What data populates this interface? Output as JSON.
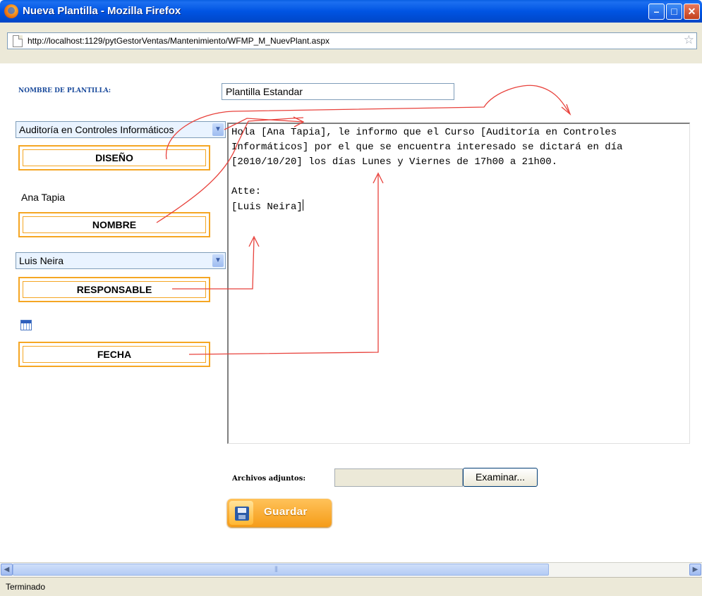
{
  "window": {
    "title": "Nueva Plantilla - Mozilla Firefox",
    "minimize": "–",
    "maximize": "□",
    "close": "✕"
  },
  "addressbar": {
    "url": "http://localhost:1129/pytGestorVentas/Mantenimiento/WFMP_M_NuevPlant.aspx",
    "bookmark_icon": "star-icon"
  },
  "form": {
    "nombre_label": "NOMBRE DE PLANTILLA:",
    "nombre_value": "Plantilla Estandar",
    "curso_select": "Auditoría en Controles Informáticos",
    "diseno_button": "DISEÑO",
    "alumno_name": "Ana Tapia",
    "nombre_button": "NOMBRE",
    "responsable_select": "Luis Neira",
    "responsable_button": "RESPONSABLE",
    "calendar_icon": "calendar-icon",
    "fecha_button": "FECHA",
    "editor_text": "Hola [Ana Tapia], le informo que el Curso [Auditoría en Controles Informáticos] por el que se encuentra interesado se dictará en día [2010/10/20] los días Lunes y Viernes de 17h00 a 21h00.\n\nAtte:\n[Luis Neira]",
    "adjuntos_label": "Archivos adjuntos:",
    "examinar_button": "Examinar...",
    "guardar_button": "Guardar"
  },
  "statusbar": {
    "text": "Terminado"
  },
  "colors": {
    "accent_orange": "#f5a623",
    "annotation_red": "#e8423c",
    "titlebar_blue": "#0054e3"
  }
}
